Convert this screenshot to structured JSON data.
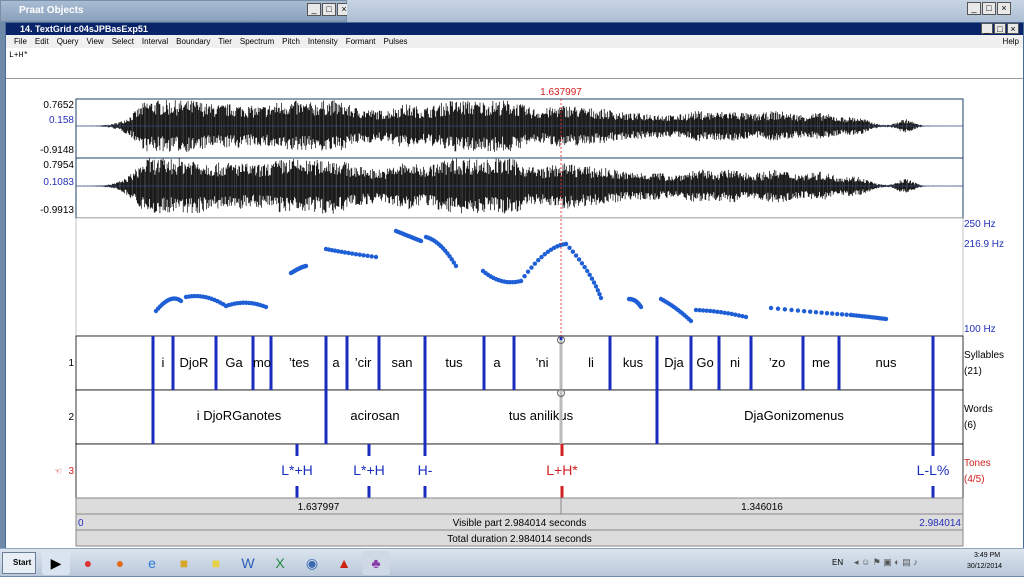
{
  "objects_window": {
    "title": "Praat Objects"
  },
  "editor": {
    "title": "14. TextGrid c04sJPBasExp51",
    "menus": [
      "File",
      "Edit",
      "Query",
      "View",
      "Select",
      "Interval",
      "Boundary",
      "Tier",
      "Spectrum",
      "Pitch",
      "Intensity",
      "Formant",
      "Pulses"
    ],
    "help_menu": "Help",
    "text_value": "L+H*",
    "cursor_time": "1.637997",
    "wave1": {
      "max": "0.7652",
      "zero": "0.158",
      "min": "-0.9148"
    },
    "wave2": {
      "max": "0.7954",
      "zero": "0.1083",
      "min": "-0.9913"
    },
    "pitch": {
      "top": "250 Hz",
      "cursor": "216.9 Hz",
      "bottom": "100 Hz"
    },
    "tiers": [
      {
        "number": "1",
        "name": "Syllables",
        "count": "(21)"
      },
      {
        "number": "2",
        "name": "Words",
        "count": "(6)"
      },
      {
        "number": "3",
        "name": "Tones",
        "count": "(4/5)"
      }
    ],
    "syllables": [
      "i",
      "DjoR",
      "Ga",
      "mo",
      "’tes",
      "a",
      "’cir",
      "san",
      "tus",
      "a",
      "’ni",
      "li",
      "kus",
      "Dja",
      "Go",
      "ni",
      "’zo",
      "me",
      "nus"
    ],
    "words": [
      "i DjoRGanotes",
      "acirosan",
      "tus anilikus",
      "DjaGonizomenus"
    ],
    "tones": [
      "L*+H",
      "L*+H",
      "H-",
      "L+H*",
      "L-L%"
    ],
    "selection_left": "1.637997",
    "selection_right": "1.346016",
    "visible_start": "0",
    "visible_label": "Visible part 2.984014 seconds",
    "visible_end": "2.984014",
    "total_label": "Total duration 2.984014 seconds"
  },
  "taskbar": {
    "start": "Start",
    "lang": "EN",
    "time": "3:49 PM",
    "date": "30/12/2014"
  },
  "colors": {
    "pitch": "#1f5fd6",
    "boundary": "#1a2dbf",
    "cursor": "#d42020",
    "title_bar": "#0a246a"
  }
}
